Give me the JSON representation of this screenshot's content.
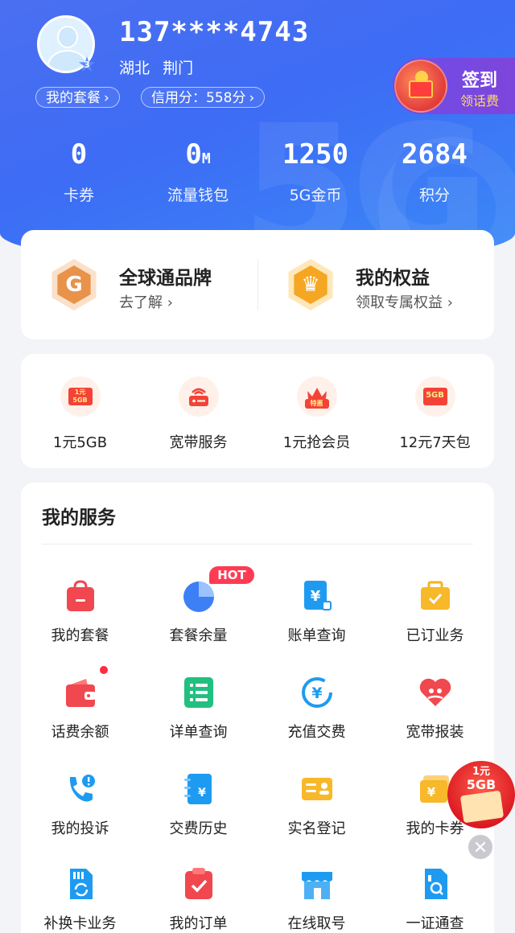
{
  "profile": {
    "phone": "137****4743",
    "province": "湖北",
    "city": "荆门",
    "level": "3",
    "plan_pill": "我的套餐",
    "credit_label": "信用分：",
    "credit_value": "558分"
  },
  "signin": {
    "title": "签到",
    "subtitle": "领话费"
  },
  "stats": [
    {
      "value": "0",
      "unit": "",
      "label": "卡券"
    },
    {
      "value": "0",
      "unit": "M",
      "label": "流量钱包"
    },
    {
      "value": "1250",
      "unit": "",
      "label": "5G金币"
    },
    {
      "value": "2684",
      "unit": "",
      "label": "积分"
    }
  ],
  "brand": [
    {
      "title": "全球通品牌",
      "subtitle": "去了解",
      "color": "#e8924a"
    },
    {
      "title": "我的权益",
      "subtitle": "领取专属权益",
      "color": "#f5a623"
    }
  ],
  "quick": [
    {
      "label": "1元5GB",
      "tag": "1元 5GB"
    },
    {
      "label": "宽带服务",
      "tag": ""
    },
    {
      "label": "1元抢会员",
      "tag": "特惠"
    },
    {
      "label": "12元7天包",
      "tag": "5GB"
    }
  ],
  "services_title": "我的服务",
  "hot_badge": "HOT",
  "services": [
    {
      "label": "我的套餐",
      "icon": "bag-icon"
    },
    {
      "label": "套餐余量",
      "icon": "pie-chart-icon"
    },
    {
      "label": "账单查询",
      "icon": "bill-icon"
    },
    {
      "label": "已订业务",
      "icon": "briefcase-check-icon"
    },
    {
      "label": "话费余额",
      "icon": "wallet-icon"
    },
    {
      "label": "详单查询",
      "icon": "list-icon"
    },
    {
      "label": "充值交费",
      "icon": "yuan-refresh-icon"
    },
    {
      "label": "宽带报装",
      "icon": "heart-icon"
    },
    {
      "label": "我的投诉",
      "icon": "phone-alert-icon"
    },
    {
      "label": "交费历史",
      "icon": "yuan-notebook-icon"
    },
    {
      "label": "实名登记",
      "icon": "id-card-icon"
    },
    {
      "label": "我的卡券",
      "icon": "coupon-icon"
    },
    {
      "label": "补换卡业务",
      "icon": "sim-swap-icon"
    },
    {
      "label": "我的订单",
      "icon": "clipboard-check-icon"
    },
    {
      "label": "在线取号",
      "icon": "store-icon"
    },
    {
      "label": "一证通查",
      "icon": "sim-search-icon"
    }
  ],
  "float_ad": {
    "line1": "1元",
    "line2": "5GB"
  }
}
